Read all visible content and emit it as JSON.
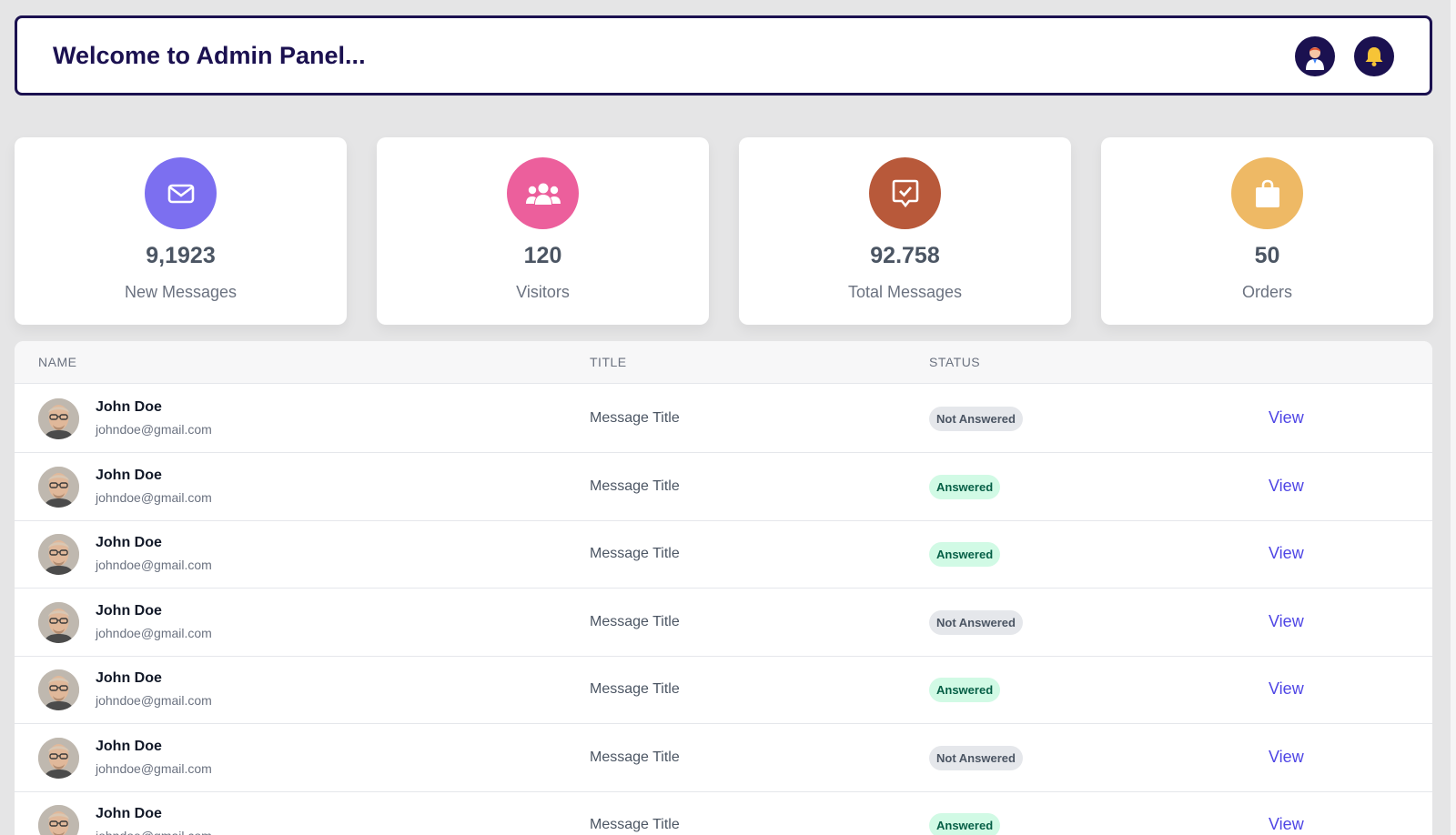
{
  "header": {
    "title": "Welcome to Admin Panel...",
    "avatar_icon": "user-avatar-icon",
    "bell_icon": "bell-icon"
  },
  "cards": [
    {
      "value": "9,1923",
      "label": "New Messages",
      "icon": "envelope-icon",
      "color": "#7c6ff0"
    },
    {
      "value": "120",
      "label": "Visitors",
      "icon": "users-icon",
      "color": "#ec5f9c"
    },
    {
      "value": "92.758",
      "label": "Total Messages",
      "icon": "comment-check-icon",
      "color": "#b8593a"
    },
    {
      "value": "50",
      "label": "Orders",
      "icon": "shopping-bag-icon",
      "color": "#eeb965"
    }
  ],
  "table": {
    "headers": {
      "name": "NAME",
      "title": "TITLE",
      "status": "STATUS"
    },
    "rows": [
      {
        "name": "John Doe",
        "email": "johndoe@gmail.com",
        "title": "Message Title",
        "status": "Not Answered",
        "action": "View"
      },
      {
        "name": "John Doe",
        "email": "johndoe@gmail.com",
        "title": "Message Title",
        "status": "Answered",
        "action": "View"
      },
      {
        "name": "John Doe",
        "email": "johndoe@gmail.com",
        "title": "Message Title",
        "status": "Answered",
        "action": "View"
      },
      {
        "name": "John Doe",
        "email": "johndoe@gmail.com",
        "title": "Message Title",
        "status": "Not Answered",
        "action": "View"
      },
      {
        "name": "John Doe",
        "email": "johndoe@gmail.com",
        "title": "Message Title",
        "status": "Answered",
        "action": "View"
      },
      {
        "name": "John Doe",
        "email": "johndoe@gmail.com",
        "title": "Message Title",
        "status": "Not Answered",
        "action": "View"
      },
      {
        "name": "John Doe",
        "email": "johndoe@gmail.com",
        "title": "Message Title",
        "status": "Answered",
        "action": "View"
      }
    ]
  }
}
